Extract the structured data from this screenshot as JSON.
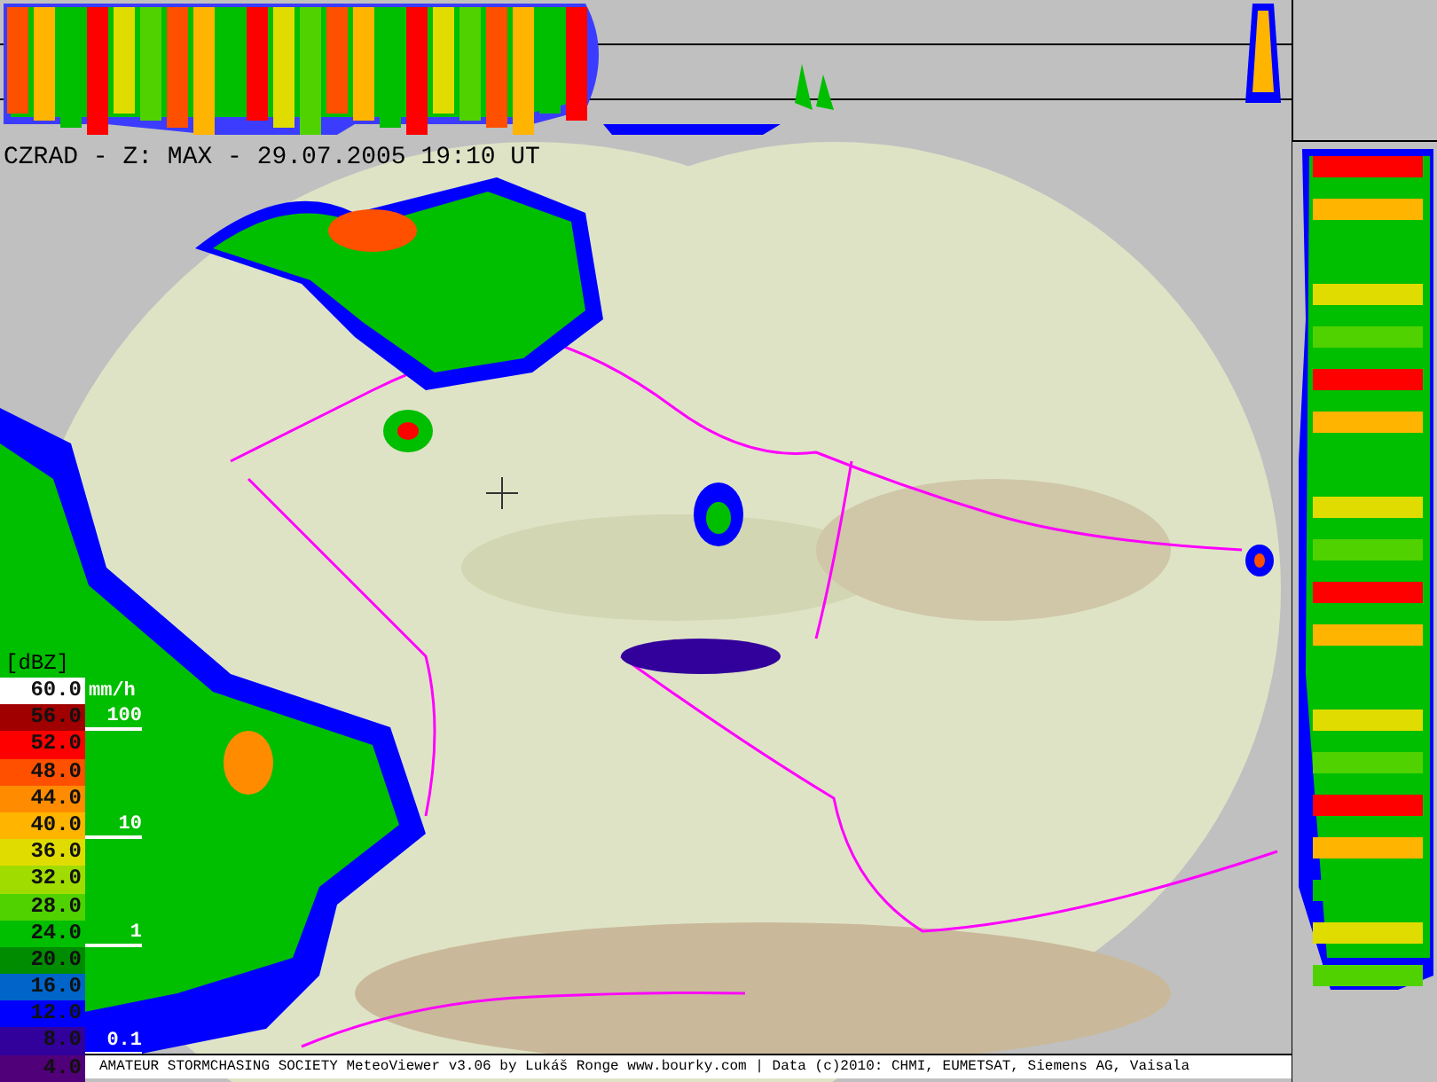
{
  "title": "CZRAD - Z: MAX - 29.07.2005 19:10 UT",
  "legend": {
    "unit": "[dBZ]",
    "rain_unit": "mm/h",
    "items": [
      {
        "value": "60.0",
        "color": "#ffffff"
      },
      {
        "value": "56.0",
        "color": "#a00000"
      },
      {
        "value": "52.0",
        "color": "#ff0000"
      },
      {
        "value": "48.0",
        "color": "#ff5000"
      },
      {
        "value": "44.0",
        "color": "#ff8c00"
      },
      {
        "value": "40.0",
        "color": "#ffb400"
      },
      {
        "value": "36.0",
        "color": "#e1dc00"
      },
      {
        "value": "32.0",
        "color": "#a0dc00"
      },
      {
        "value": "28.0",
        "color": "#50d200"
      },
      {
        "value": "24.0",
        "color": "#00be00"
      },
      {
        "value": "20.0",
        "color": "#008c00"
      },
      {
        "value": "16.0",
        "color": "#0064c8"
      },
      {
        "value": "12.0",
        "color": "#0000ff"
      },
      {
        "value": "8.0",
        "color": "#32009b"
      },
      {
        "value": "4.0",
        "color": "#500078"
      }
    ],
    "rain_ticks": [
      "100",
      "10",
      "1",
      "0.1"
    ]
  },
  "status_bar": "AMATEUR STORMCHASING SOCIETY MeteoViewer v3.06 by Lukáš Ronge www.bourky.com | Data (c)2010: CHMI, EUMETSAT, Siemens AG, Vaisala"
}
